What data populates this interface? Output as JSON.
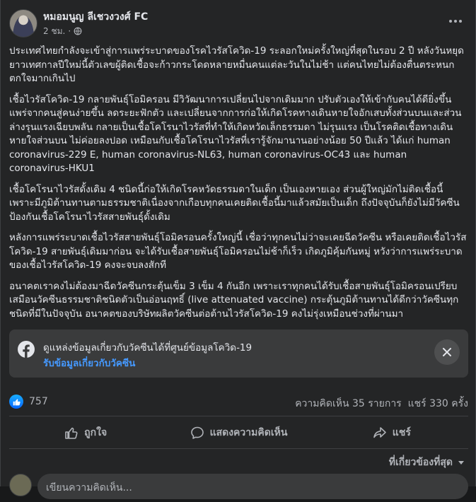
{
  "post": {
    "author": "หมอมนูญ ลีเชวงวงศ์ FC",
    "time": "2 ชม.",
    "audience_icon": "globe-icon",
    "paragraphs": [
      "ประเทศไทยกำลังจะเข้าสู่การแพร่ระบาดของโรคไวรัสโควิด-19 ระลอกใหม่ครั้งใหญ่ที่สุดในรอบ 2 ปี หลังวันหยุดยาวเทศกาลปีใหม่นี้ตัวเลขผู้ติดเชื้อจะก้าวกระโดดหลายหมื่นคนแต่ละวันในไม่ช้า แต่คนไทยไม่ต้องตื่นตระหนกตกใจมากเกินไป",
      "เชื้อไวรัสโควิด-19 กลายพันธุ์โอมิครอน มีวิวัฒนาการเปลี่ยนไปจากเดิมมาก ปรับตัวเองให้เข้ากับคนได้ดียิ่งขึ้น แพร่จากคนสู่คนง่ายขึ้น ลดระยะฟักตัว และเปลี่ยนจากการก่อให้เกิดโรคทางเดินหายใจอักเสบทั้งส่วนบนและส่วนล่างรุนแรงเฉียบพลัน กลายเป็นเชื้อโคโรนาไวรัสที่ทำให้เกิดหวัดเล็กธรรมดา ไม่รุนแรง เป็นโรคติดเชื้อทางเดินหายใจส่วนบน ไม่ค่อยลงปอด เหมือนกับเชื้อโคโรนาไวรัสที่เรารู้จักมานานอย่างน้อย 50 ปีแล้ว ได้แก่ human coronavirus-229 E,  human coronavirus-NL63, human coronavirus-OC43 และ human coronavirus-HKU1",
      "เชื้อโคโรนาไวรัสดั้งเดิม 4 ชนิดนี้ก่อให้เกิดโรคหวัดธรรมดาในเด็ก เป็นเองหายเอง ส่วนผู้ใหญ่มักไม่ติดเชื้อนี้ เพราะมีภูมิต้านทานตามธรรมชาติเนื่องจากเกือบทุกคนเคยติดเชื้อนี้มาแล้วสมัยเป็นเด็ก ถึงปัจจุบันก็ยังไม่มีวัคซีนป้องกันเชื้อโคโรนาไวรัสสายพันธุ์ดั้งเดิม",
      "หลังการแพร่ระบาดเชื้อไวรัสสายพันธุ์โอมิครอนครั้งใหญ่นี้ เชื่อว่าทุกคนไม่ว่าจะเคยฉีดวัคซีน หรือเคยติดเชื้อไวรัสโควิด-19 สายพันธุ์เดิมมาก่อน จะได้รับเชื้อสายพันธุ์โอมิครอนไม่ช้าก็เร็ว เกิดภูมิคุ้มกันหมู่ หวังว่าการแพร่ระบาดของเชื้อไวรัสโควิด-19 คงจะจบลงสักที",
      "อนาคตเราคงไม่ต้องมาฉีดวัคซีนกระตุ้นเข็ม 3 เข็ม 4 กันอีก เพราะเราทุกคนได้รับเชื้อสายพันธุ์โอมิครอนเปรียบเสมือนวัคซีนธรรมชาติชนิดตัวเป็นอ่อนฤทธิ์ (live attenuated vaccine) กระตุ้นภูมิต้านทานได้ดีกว่าวัคซีนทุกชนิดที่มีในปัจจุบัน อนาคตของบริษัทผลิตวัคซีนต่อต้านไวรัสโควิด-19 คงไม่รุ่งเหมือนช่วงที่ผ่านมา"
    ]
  },
  "info_box": {
    "title": "ดูแหล่งข้อมูลเกี่ยวกับวัคซีนได้ที่ศูนย์ข้อมูลโควิด-19",
    "link": "รับข้อมูลเกี่ยวกับวัคซีน"
  },
  "stats": {
    "likes": "757",
    "comments": "ความคิดเห็น 35 รายการ",
    "shares": "แชร์ 330 ครั้ง"
  },
  "actions": {
    "like": "ถูกใจ",
    "comment": "แสดงความคิดเห็น",
    "share": "แชร์"
  },
  "sort": {
    "label": "ที่เกี่ยวข้องที่สุด"
  },
  "comment_box": {
    "placeholder": "เขียนความคิดเห็น..."
  },
  "colors": {
    "background": "#242526",
    "link": "#4599ff",
    "like_blue": "#0866ff"
  }
}
